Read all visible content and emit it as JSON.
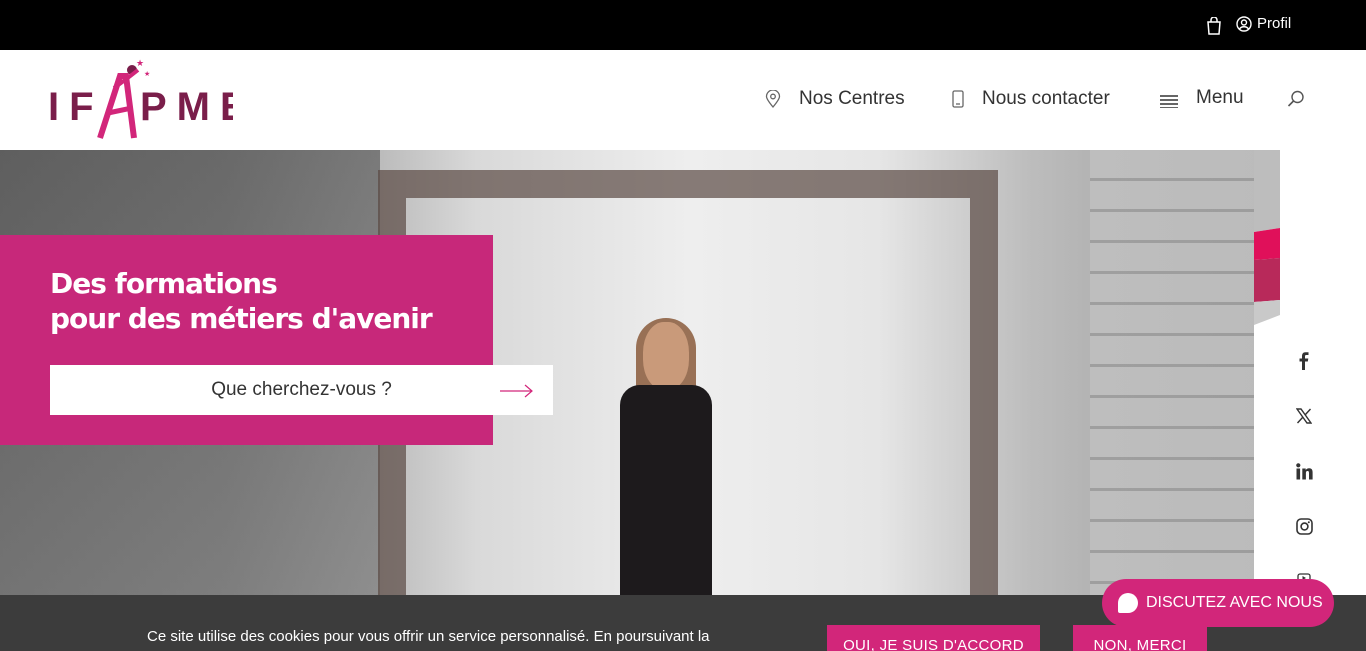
{
  "topbar": {
    "profile_label": "Profil"
  },
  "header": {
    "logo_text": "IFAPME",
    "nav": [
      {
        "label": "Nos Centres",
        "icon": "location-pin-icon"
      },
      {
        "label": "Nous contacter",
        "icon": "phone-icon"
      },
      {
        "label": "Menu",
        "icon": "hamburger-icon"
      }
    ]
  },
  "hero": {
    "title_line1": "Des formations",
    "title_line2": "pour des métiers d'avenir",
    "search_label": "Que cherchez-vous ?"
  },
  "social": [
    "facebook-icon",
    "x-icon",
    "linkedin-icon",
    "instagram-icon",
    "youtube-icon"
  ],
  "cookie": {
    "text": "Ce site utilise des cookies pour vous offrir un service personnalisé. En poursuivant la navigation, vous acceptez leur utilisation. En savoir plus",
    "accept_label": "OUI, JE SUIS D'ACCORD",
    "decline_label": "NON, MERCI"
  },
  "chat": {
    "label": "DISCUTEZ AVEC NOUS"
  },
  "colors": {
    "brand_pink": "#c7287a",
    "brand_maroon": "#7a1e4a",
    "topbar": "#000000"
  }
}
